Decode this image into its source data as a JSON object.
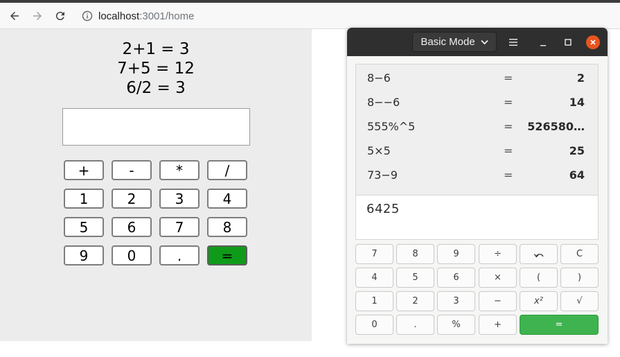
{
  "browser": {
    "url_host": "localhost",
    "url_rest": ":3001/home"
  },
  "webapp": {
    "history": [
      "2+1 = 3",
      "7+5 = 12",
      "6/2 = 3"
    ],
    "input_value": "",
    "buttons": [
      [
        "+",
        "-",
        "*",
        "/"
      ],
      [
        "1",
        "2",
        "3",
        "4"
      ],
      [
        "5",
        "6",
        "7",
        "8"
      ],
      [
        "9",
        "0",
        ".",
        "="
      ]
    ],
    "equals_color": "#0f9a1a"
  },
  "calculator": {
    "mode_label": "Basic Mode",
    "history": [
      {
        "expr": "8−6",
        "eq": "=",
        "result": "2"
      },
      {
        "expr": "8−−6",
        "eq": "=",
        "result": "14"
      },
      {
        "expr": "555%^5",
        "eq": "=",
        "result": "526580…"
      },
      {
        "expr": "5×5",
        "eq": "=",
        "result": "25"
      },
      {
        "expr": "73−9",
        "eq": "=",
        "result": "64"
      }
    ],
    "display": "6425",
    "keys": [
      [
        "7",
        "8",
        "9",
        "÷",
        "undo",
        "C"
      ],
      [
        "4",
        "5",
        "6",
        "×",
        "(",
        ")"
      ],
      [
        "1",
        "2",
        "3",
        "−",
        "x²",
        "√"
      ],
      [
        "0",
        ".",
        "%",
        "+",
        "="
      ]
    ],
    "close_color": "#e95420",
    "equals_color": "#3eb34f"
  }
}
